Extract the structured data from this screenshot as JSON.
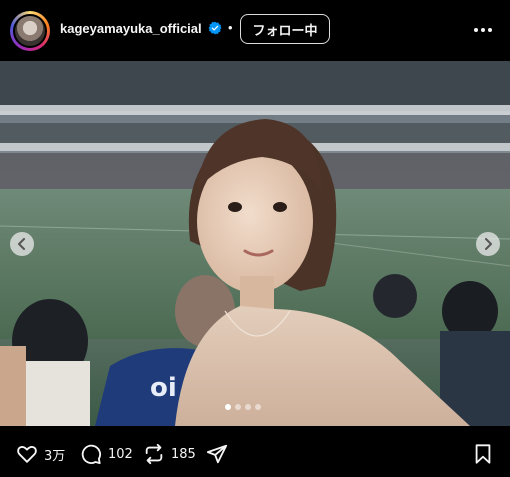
{
  "post": {
    "username": "kageyamayuka_official",
    "separator": "•",
    "follow_label": "フォロー中"
  },
  "actions": {
    "likes": "3万",
    "comments": "102",
    "reposts": "185"
  },
  "icons": {
    "verified": "verified-badge-icon",
    "more": "more-options-icon",
    "like": "heart-icon",
    "comment": "comment-bubble-icon",
    "repost": "repost-icon",
    "share": "share-paper-plane-icon",
    "bookmark": "bookmark-icon",
    "prev": "chevron-left-icon",
    "next": "chevron-right-icon"
  },
  "colors": {
    "background": "#000000",
    "verified": "#0095f6",
    "text": "#f5f5f5"
  }
}
